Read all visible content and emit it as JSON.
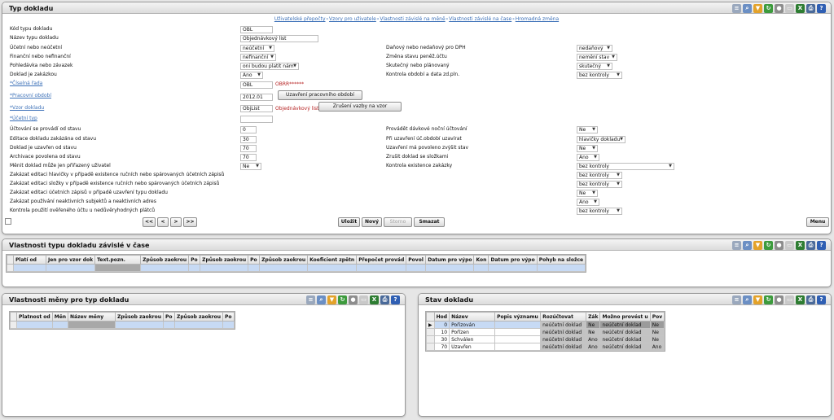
{
  "typ": {
    "title": "Typ dokladu",
    "links": [
      "Uživatelské přepočty",
      "Vzory pro uživatele",
      "Vlastnosti závislé na měně",
      "Vlastnosti závislé na čase",
      "Hromadná změna"
    ],
    "kod_label": "Kód typu dokladu",
    "kod_value": "OBL",
    "nazev_label": "Název typu dokladu",
    "nazev_value": "Objednávkový list",
    "ucetni_label": "Účetní nebo neúčetní",
    "ucetni_value": "neúčetní",
    "dan_label": "Daňový nebo nedaňový pro DPH",
    "dan_value": "nedaňový",
    "fin_label": "Finanční nebo nefinanční",
    "fin_value": "nefinanční",
    "zmena_label": "Změna stavu peněž.účtu",
    "zmena_value": "nemění stav",
    "pohl_label": "Pohledávka nebo závazek",
    "pohl_value": "oni budou platit nám",
    "skut_label": "Skutečný nebo plánovaný",
    "skut_value": "skutečný",
    "zak_label": "Doklad je zakázkou",
    "zak_value": "Ano",
    "kontrola_label": "Kontrola období a data zd.pln.",
    "kontrola_value": "bez kontroly",
    "rada_label": "Číselná řada",
    "rada_value": "OBL",
    "rada_note": "OBRR******",
    "obdobi_label": "Pracovní období",
    "obdobi_value": "2012.01",
    "uzavreni_btn": "Uzavření pracovního období",
    "vzor_label": "Vzor dokladu",
    "vzor_value": "ObjList",
    "vzor_note": "Objednávkový list",
    "zruseni_btn": "Zrušení vazby na vzor",
    "ucetni_typ_label": "Účetní typ",
    "uct_stav_label": "Účtování se provádí od stavu",
    "uct_stav_value": "0",
    "davk_label": "Provádět dávkové noční účtování",
    "davk_value": "Ne",
    "edit_label": "Editace dokladu zakázána od stavu",
    "edit_value": "30",
    "pri_label": "Při uzavření úč.období uzavírat",
    "pri_value": "hlavičky dokladu",
    "uzav_label": "Doklad je uzavřen od stavu",
    "uzav_value": "70",
    "povol_label": "Uzavření má povoleno zvýšit stav",
    "povol_value": "Ne",
    "arch_label": "Archivace povolena od stavu",
    "arch_value": "70",
    "zrus_label": "Zrušit doklad se složkami",
    "zrus_value": "Ano",
    "menit_label": "Měnit doklad může jen přiřazený uživatel",
    "menit_value": "Ne",
    "kex_label": "Kontrola existence zakázky",
    "kex_value": "bez kontroly",
    "z1_label": "Zakázat editaci hlavičky v případě existence ručních nebo spárovaných účetních zápisů",
    "z1_value": "bez kontroly",
    "z2_label": "Zakázat editaci složky v případě existence ručních nebo spárovaných účetních zápisů",
    "z2_value": "bez kontroly",
    "z3_label": "Zakázat editaci účetních zápisů v případě uzavření typu dokladu",
    "z3_value": "Ne",
    "z4_label": "Zakázat používání neaktivních subjektů a neaktivních adres",
    "z4_value": "Ano",
    "z5_label": "Kontrola použití ověřeného účtu u nedůvěryhodných plátců",
    "z5_value": "bez kontroly",
    "nav": [
      "<<",
      "<",
      ">",
      ">>"
    ],
    "actions": [
      "Uložit",
      "Nový",
      "Storno",
      "Smazat"
    ],
    "menu": "Menu"
  },
  "cas": {
    "title": "Vlastnosti typu dokladu závislé v čase",
    "cols": [
      "Platí od",
      "Jen pro vzor dok",
      "Text.pozn.",
      "Způsob zaokrou",
      "Po",
      "Způsob zaokrou",
      "Po",
      "Způsob zaokrou",
      "Koeficient zpětn",
      "Přepočet provád",
      "Povol",
      "Datum pro výpo",
      "Kon",
      "Datum pro výpo",
      "Pohyb na složce"
    ]
  },
  "mena": {
    "title": "Vlastnosti měny pro typ dokladu",
    "cols": [
      "Platnost od",
      "Měn",
      "Název měny",
      "Způsob zaokrou",
      "Po",
      "Způsob zaokrou",
      "Po"
    ]
  },
  "stav": {
    "title": "Stav dokladu",
    "cols": [
      "Hod",
      "Název",
      "Popis významu",
      "Rozúčtovat",
      "Zák",
      "Možno provést u",
      "Pov"
    ],
    "rows": [
      [
        "0",
        "Pořizován",
        "",
        "neúčetní doklad",
        "Ne",
        "neúčetní doklad",
        "Ne"
      ],
      [
        "10",
        "Pořízen",
        "",
        "neúčetní doklad",
        "Ne",
        "neúčetní doklad",
        "Ne"
      ],
      [
        "30",
        "Schválen",
        "",
        "neúčetní doklad",
        "Ano",
        "neúčetní doklad",
        "Ne"
      ],
      [
        "70",
        "Uzavřen",
        "",
        "neúčetní doklad",
        "Ano",
        "neúčetní doklad",
        "Ano"
      ]
    ]
  },
  "toolbar_icons": [
    "document-icon",
    "search-icon",
    "filter-icon",
    "refresh-icon",
    "disk-icon",
    "page-icon",
    "excel-icon",
    "print-icon",
    "help-icon"
  ]
}
